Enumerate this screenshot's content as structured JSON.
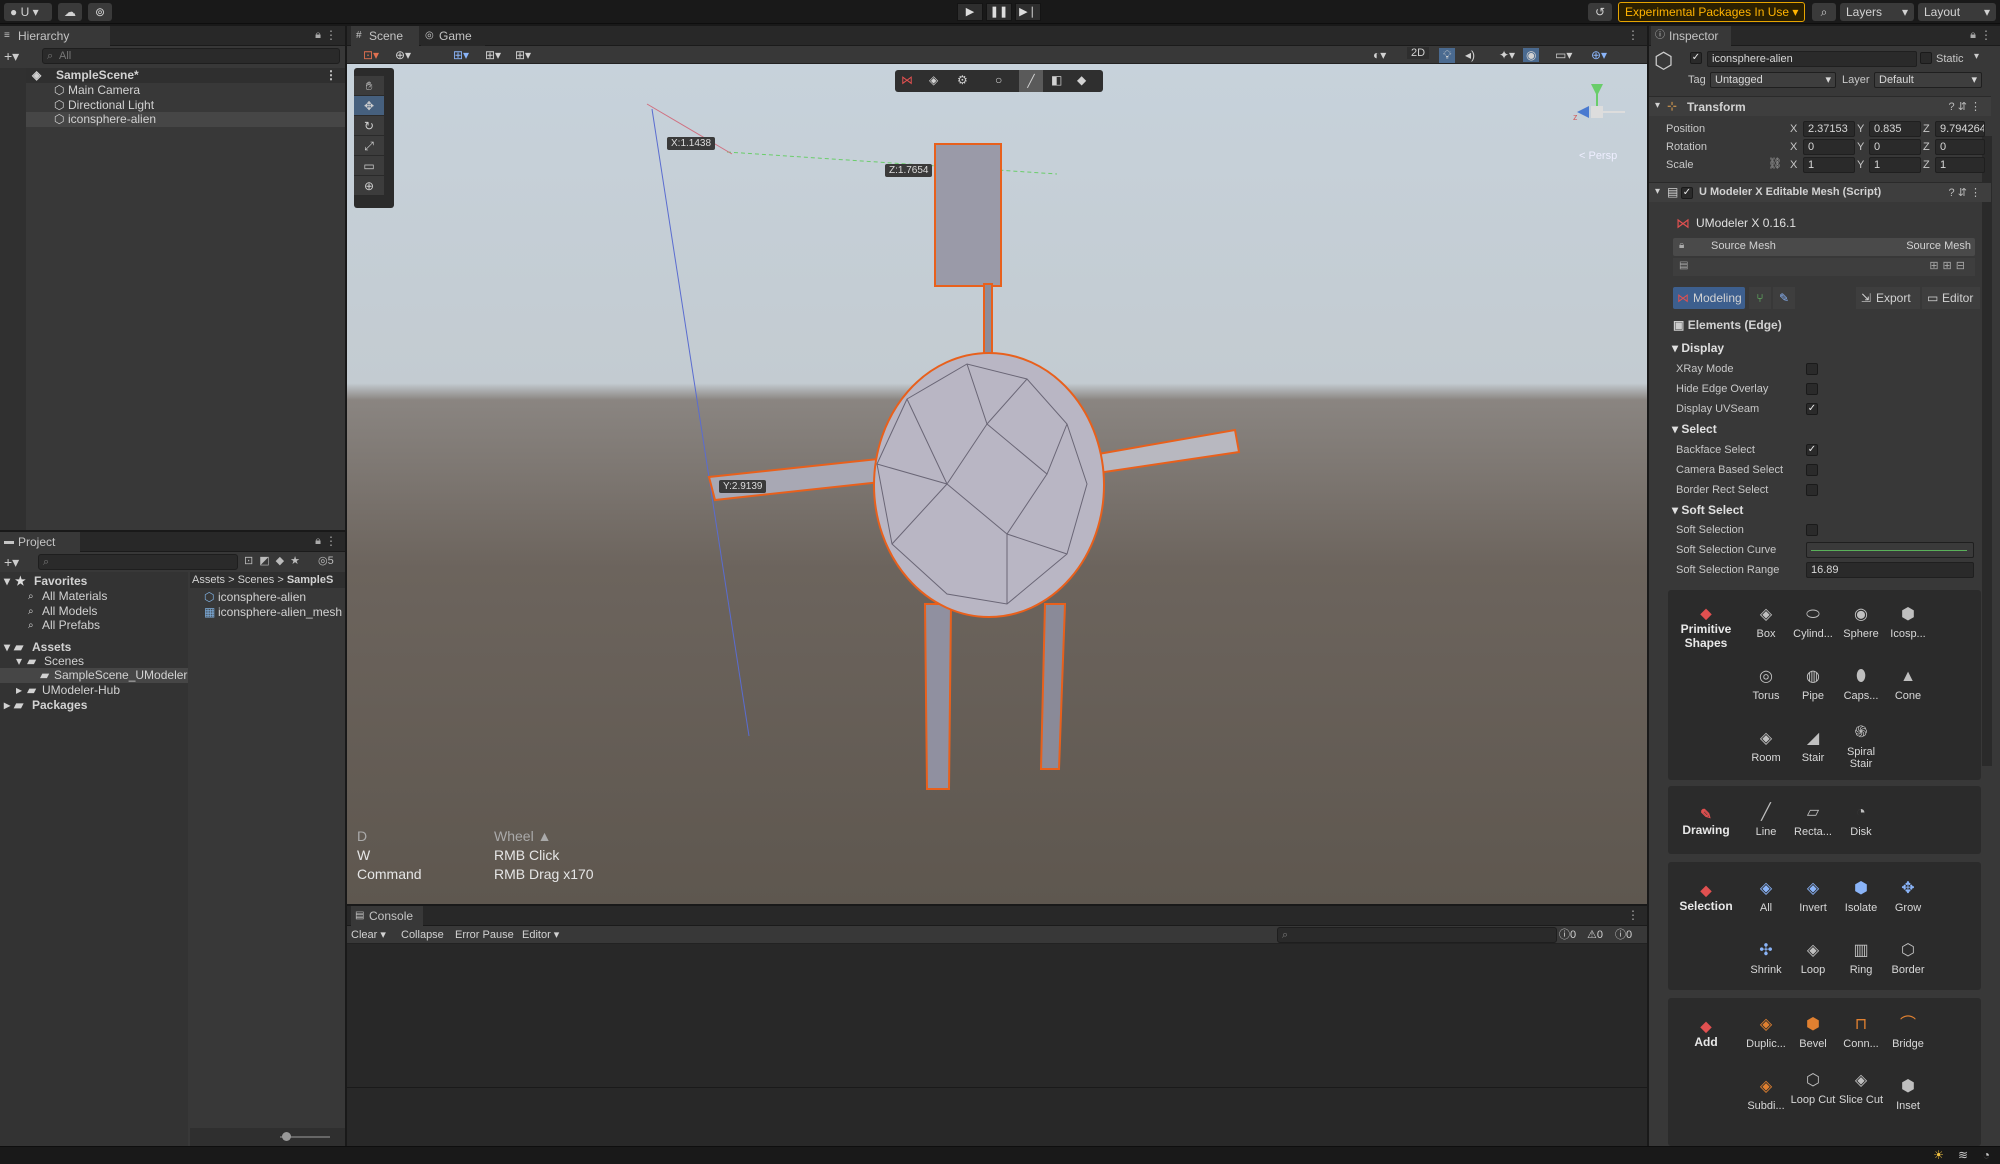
{
  "toolbar": {
    "account": "U",
    "experimental": "Experimental Packages In Use",
    "layers": "Layers",
    "layout": "Layout"
  },
  "hierarchy": {
    "tab": "Hierarchy",
    "search_placeholder": "All",
    "scene": "SampleScene*",
    "items": [
      "Main Camera",
      "Directional Light",
      "iconsphere-alien"
    ]
  },
  "project": {
    "tab": "Project",
    "hidden_count": "5",
    "favorites": {
      "label": "Favorites",
      "items": [
        "All Materials",
        "All Models",
        "All Prefabs"
      ]
    },
    "assets_label": "Assets",
    "scenes_label": "Scenes",
    "tree_items": [
      "SampleScene_UModeler",
      "UModeler-Hub"
    ],
    "packages_label": "Packages",
    "breadcrumb": [
      "Assets",
      "Scenes",
      "SampleS"
    ],
    "files": [
      "iconsphere-alien",
      "iconsphere-alien_mesh"
    ]
  },
  "scene_view": {
    "tabs": [
      "Scene",
      "Game"
    ],
    "mode_2d": "2D",
    "persp": "< Persp",
    "tags": {
      "x": "X:1.1438",
      "z": "Z:1.7654",
      "y": "Y:2.9139"
    },
    "hints": [
      {
        "key": "D",
        "action": "Wheel ▲"
      },
      {
        "key": "W",
        "action": "RMB Click"
      },
      {
        "key": "Command",
        "action": "RMB Drag x170"
      }
    ]
  },
  "console": {
    "tab": "Console",
    "buttons": [
      "Clear",
      "Collapse",
      "Error Pause",
      "Editor"
    ],
    "counts": {
      "log": "0",
      "warn": "0",
      "error": "0"
    }
  },
  "inspector": {
    "tab": "Inspector",
    "object_name": "iconsphere-alien",
    "static_label": "Static",
    "tag_label": "Tag",
    "tag_value": "Untagged",
    "layer_label": "Layer",
    "layer_value": "Default",
    "transform": {
      "title": "Transform",
      "position": {
        "label": "Position",
        "x": "2.37153",
        "y": "0.835",
        "z": "9.794264"
      },
      "rotation": {
        "label": "Rotation",
        "x": "0",
        "y": "0",
        "z": "0"
      },
      "scale": {
        "label": "Scale",
        "x": "1",
        "y": "1",
        "z": "1"
      }
    },
    "script_title": "U Modeler X Editable Mesh (Script)",
    "umodeler": {
      "version": "UModeler X 0.16.1",
      "source_mesh_label": "Source Mesh",
      "source_mesh_value": "Source Mesh",
      "modeling": "Modeling",
      "export": "Export",
      "editor": "Editor",
      "elements": "Elements (Edge)",
      "display_head": "Display",
      "display": [
        {
          "label": "XRay Mode",
          "checked": false
        },
        {
          "label": "Hide Edge Overlay",
          "checked": false
        },
        {
          "label": "Display UVSeam",
          "checked": true
        }
      ],
      "select_head": "Select",
      "select": [
        {
          "label": "Backface Select",
          "checked": true
        },
        {
          "label": "Camera Based Select",
          "checked": false
        },
        {
          "label": "Border Rect Select",
          "checked": false
        }
      ],
      "soft_head": "Soft Select",
      "soft_selection": "Soft Selection",
      "soft_curve": "Soft Selection Curve",
      "soft_range_label": "Soft Selection Range",
      "soft_range_value": "16.89"
    },
    "categories": {
      "primitive": {
        "label": "Primitive Shapes",
        "items": [
          "Box",
          "Cylind...",
          "Sphere",
          "Icosp...",
          "Torus",
          "Pipe",
          "Caps...",
          "Cone",
          "Room",
          "Stair",
          "Spiral Stair"
        ]
      },
      "drawing": {
        "label": "Drawing",
        "items": [
          "Line",
          "Recta...",
          "Disk"
        ]
      },
      "selection": {
        "label": "Selection",
        "items": [
          "All",
          "Invert",
          "Isolate",
          "Grow",
          "Shrink",
          "Loop",
          "Ring",
          "Border"
        ]
      },
      "add": {
        "label": "Add",
        "items": [
          "Duplic...",
          "Bevel",
          "Conn...",
          "Bridge",
          "Subdi...",
          "Loop Cut",
          "Slice Cut",
          "Inset"
        ]
      }
    }
  }
}
